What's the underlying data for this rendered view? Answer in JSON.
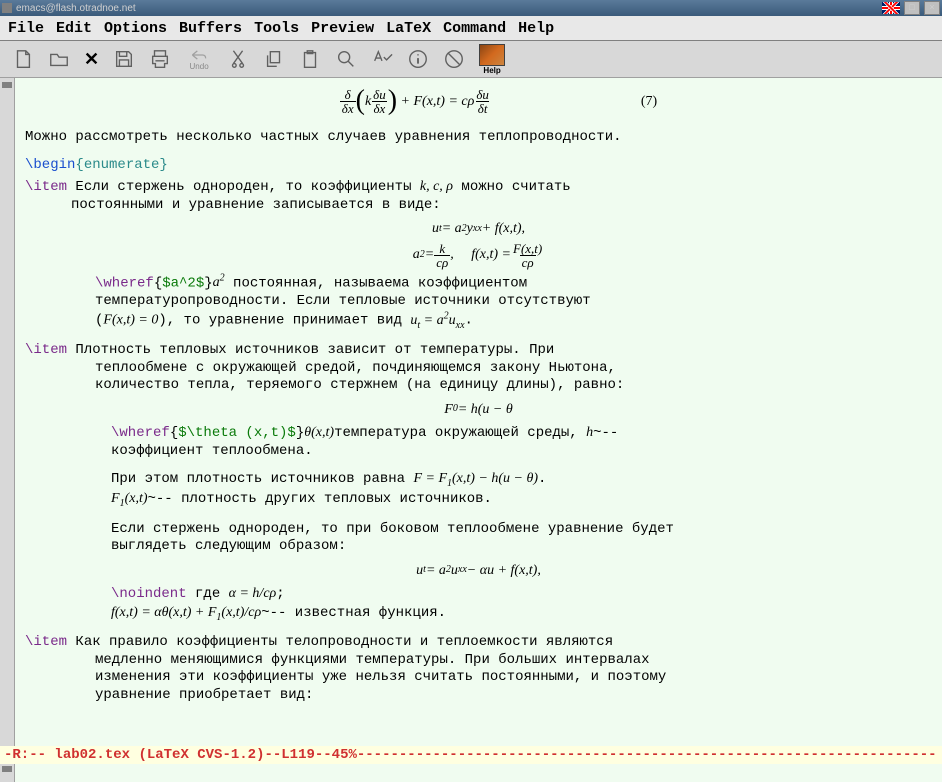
{
  "window": {
    "title": "emacs@flash.otradnoe.net"
  },
  "menubar": [
    "File",
    "Edit",
    "Options",
    "Buffers",
    "Tools",
    "Preview",
    "LaTeX",
    "Command",
    "Help"
  ],
  "toolbar": {
    "undo_label": "Undo",
    "help_label": "Help"
  },
  "doc": {
    "eq7_num": "(7)",
    "intro": "Можно рассмотреть несколько частных случаев уравнения теплопроводности.",
    "begin_kw": "\\begin",
    "begin_arg": "{enumerate}",
    "item_kw": "\\item",
    "i1_l1": " Если стержень однороден, то коэффициенты ",
    "i1_coefs": "k, c, ρ",
    "i1_l1b": " можно считать",
    "i1_l2": "постоянными и уравнение записывается в виде:",
    "wheref_kw": "\\wheref",
    "wheref1_arg": "{$a^2$}",
    "wheref1_txt": " постоянная, называема коэффициентом",
    "wheref1_b": "температуропроводности. Если тепловые источники отсутствуют",
    "wheref1_c_pre": "(",
    "wheref1_c_math": "F(x,t) = 0",
    "wheref1_c_mid": "), то уравнение принимает вид ",
    "wheref1_c_math2": "u_t = a²u_xx",
    "wheref1_c_end": ".",
    "i2_l1": " Плотность тепловых источников зависит от температуры. При",
    "i2_l2": "теплообмене с окружающей средой, почдиняющемся закону Ньютона,",
    "i2_l3": "количество тепла, теряемого стержнем (на единицу длины), равно:",
    "wheref2_arg": "{$\\theta (x,t)$}",
    "wheref2_txt": "температура окружающей среды, ",
    "wheref2_h": "h",
    "wheref2_txt2": "~--",
    "wheref2_b": "коэффициент теплообмена.",
    "i2_p2a": "При этом плотность источников равна ",
    "i2_p2m": "F = F₁(x,t) − h(u − θ)",
    "i2_p2b": ".",
    "i2_p3": "~-- плотность других тепловых источников.",
    "i2_p4a": "Если стержень однороден, то при боковом теплообмене уравнение будет",
    "i2_p4b": "выглядеть следующим образом:",
    "noindent_kw": "\\noindent",
    "noindent_txt": " где ",
    "noindent_math": "α = h/cρ",
    "noindent_end": ";",
    "fxt_line": "~-- известная функция.",
    "i3_l1": "Как правило коэффициенты телопроводности и теплоемкости являются",
    "i3_l2": "медленно меняющимися функциями температуры. При больших интервалах",
    "i3_l3": "изменения эти коэффициенты уже нельзя считать постоянными, и поэтому",
    "i3_l4": "уравнение приобретает вид:"
  },
  "modeline": {
    "left": "-R:--  ",
    "file": "lab02.tex",
    "right": "      (LaTeX CVS-1.2)--L119--45%---------------------------------------------------------------------"
  }
}
